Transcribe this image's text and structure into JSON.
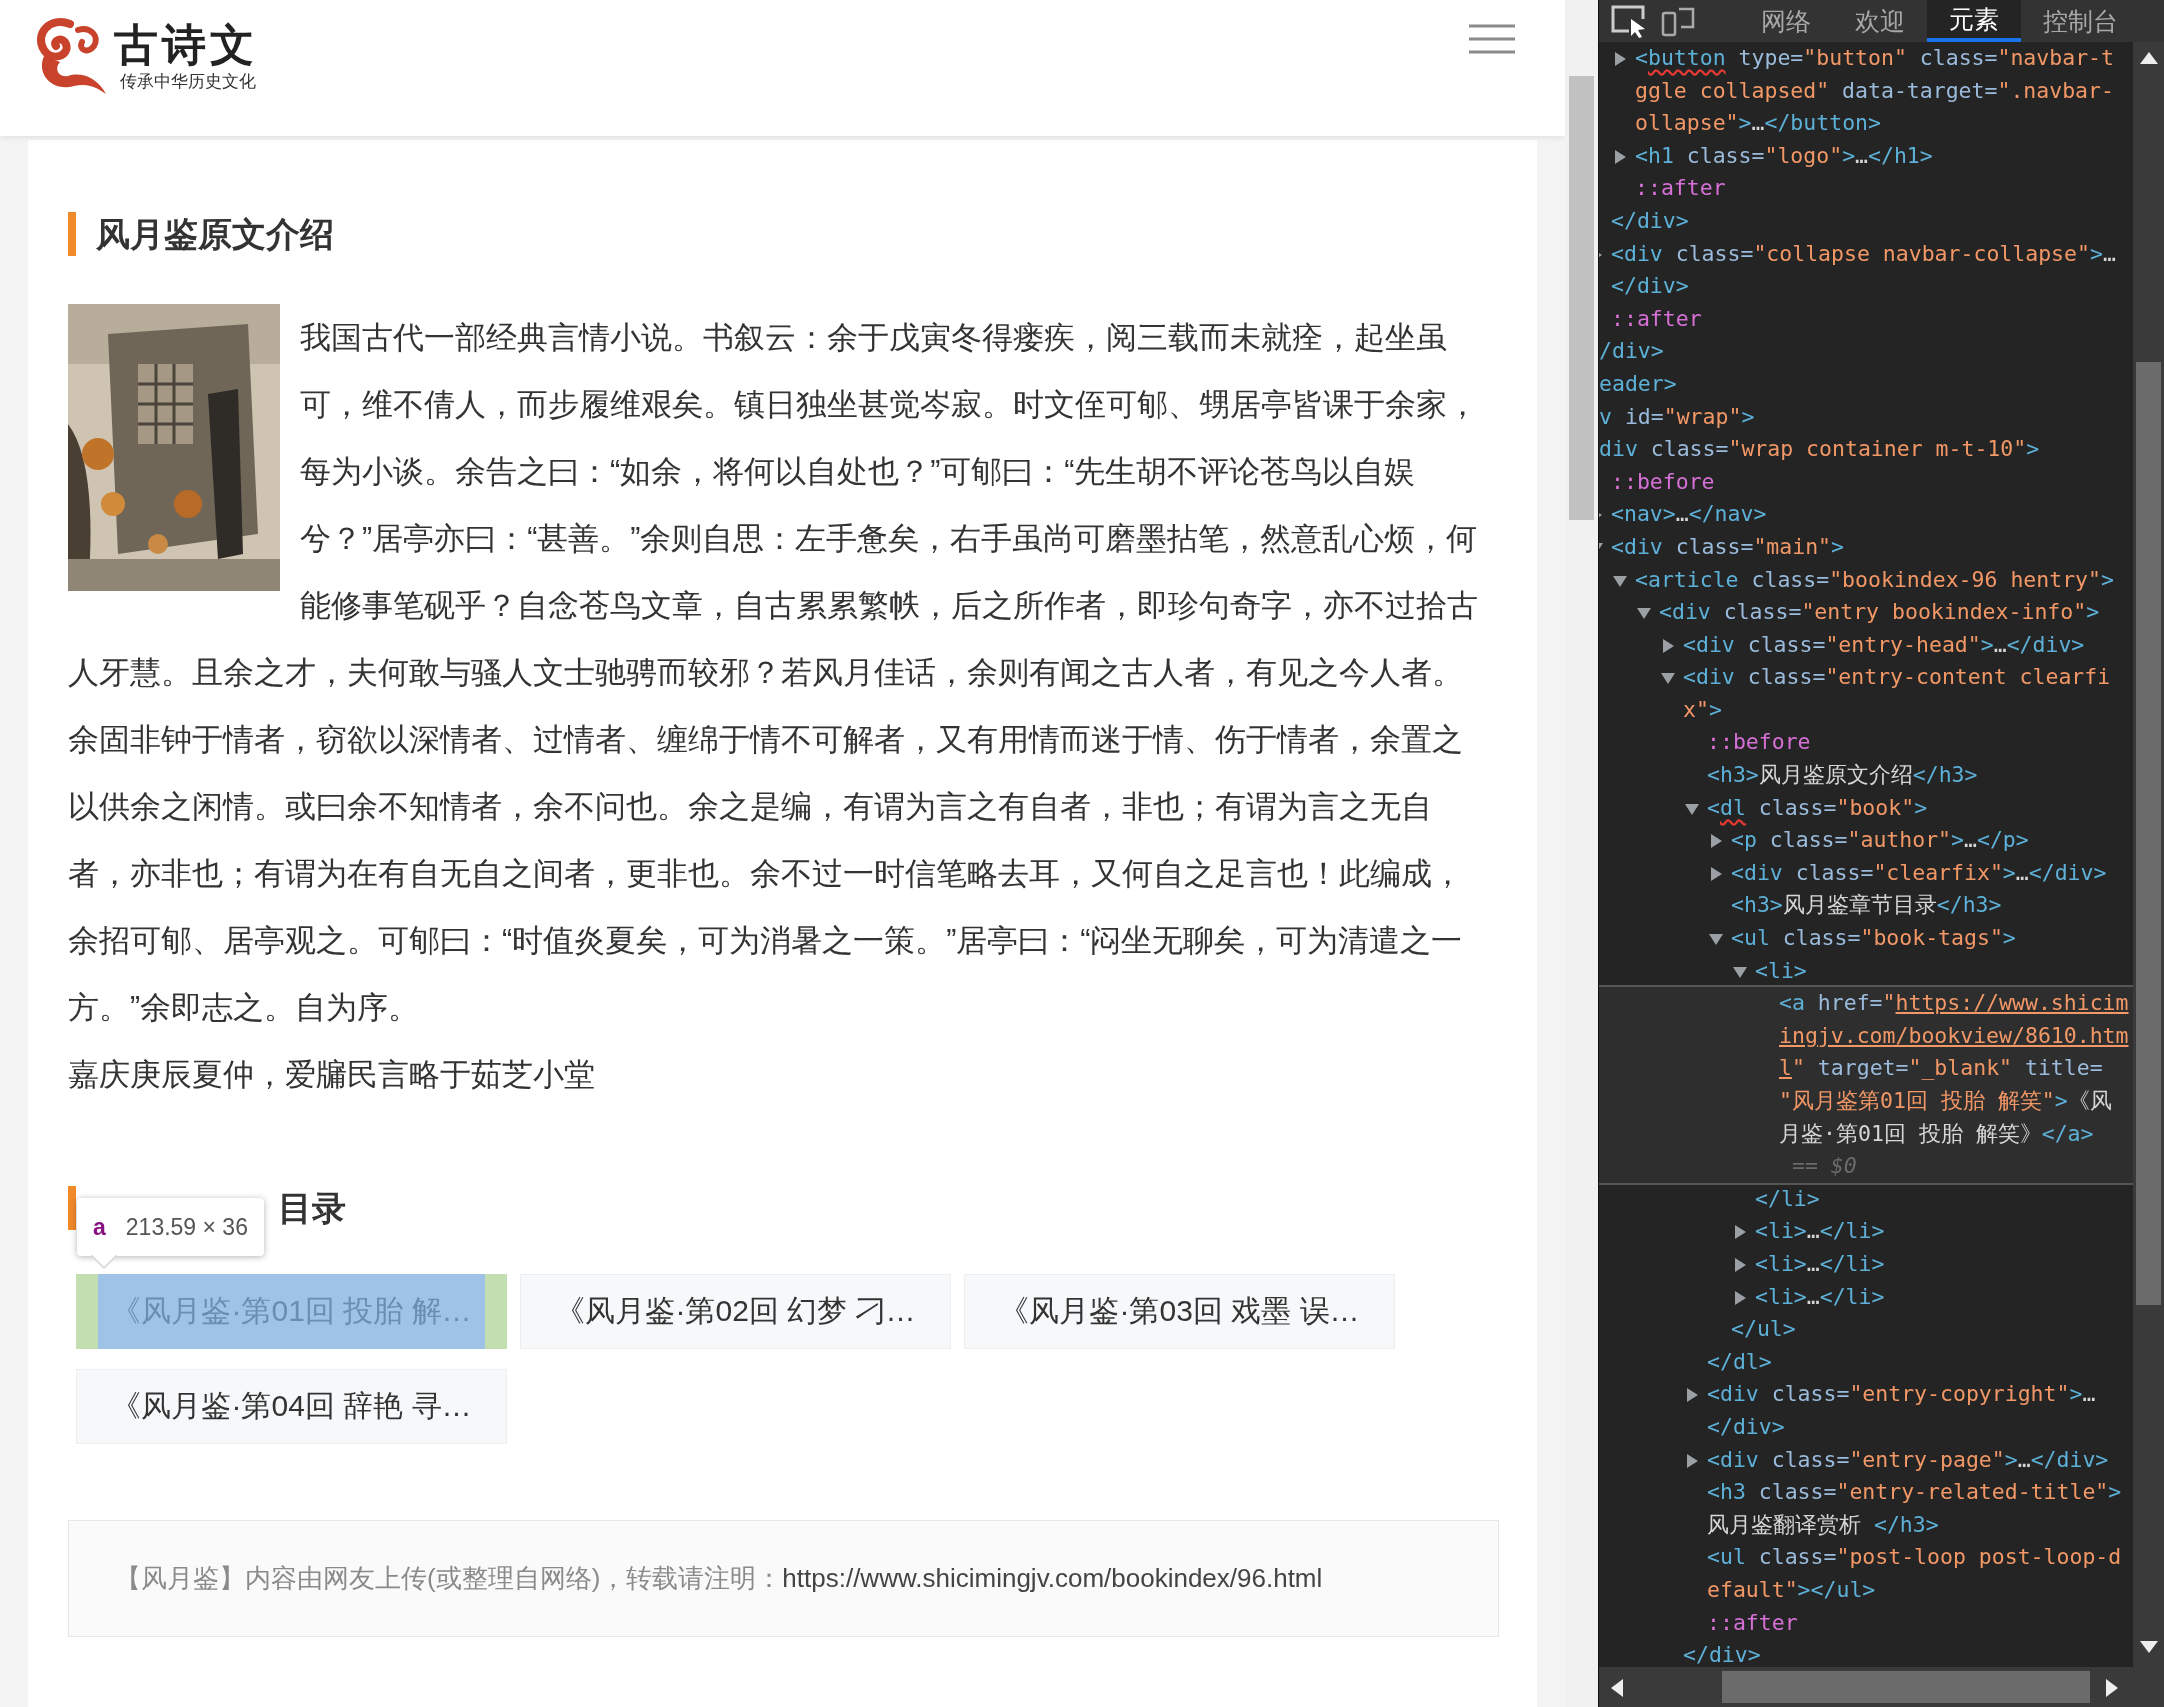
{
  "page": {
    "logo": {
      "title": "古诗文",
      "slogan": "传承中华历史文化"
    },
    "intro": {
      "heading": "风月鉴原文介绍",
      "image": {
        "kind": "picture"
      },
      "paragraphs": [
        "我国古代一部经典言情小说。书叙云：余于戊寅冬得瘘疾，阅三载而未就痊，起坐虽可，维不倩人，而步履维艰矣。镇日独坐甚觉岑寂。时文侄可郇、甥居亭皆课于余家，每为小谈。余告之曰：“如余，将何以自处也？”可郇曰：“先生胡不评论苍鸟以自娱兮？”居亭亦曰：“甚善。”余则自思：左手惫矣，右手虽尚可磨墨拈笔，然意乱心烦，何能修事笔砚乎？自念苍鸟文章，自古累累繁帙，后之所作者，即珍句奇字，亦不过拾古人牙慧。且余之才，夫何敢与骚人文士驰骋而较邪？若风月佳话，余则有闻之古人者，有见之今人者。余固非钟于情者，窃欲以深情者、过情者、缠绵于情不可解者，又有用情而迷于情、伤于情者，余置之以供余之闲情。或曰余不知情者，余不问也。余之是编，有谓为言之有自者，非也；有谓为言之无自者，亦非也；有谓为在有自无自之间者，更非也。余不过一时信笔略去耳，又何自之足言也！此编成，余招可郇、居亭观之。可郇曰：“时值炎夏矣，可为消暑之一策。”居亭曰：“闷坐无聊矣，可为清遣之一方。”余即志之。自为序。",
        "嘉庆庚辰夏仲，爱牖民言略于茹芝小堂"
      ]
    },
    "chapters": {
      "heading": "目录",
      "tooltip": {
        "tag": "a",
        "size": "213.59 × 36"
      },
      "tags": [
        {
          "label": "《风月鉴·第01回 投胎 解…",
          "highlighted": true
        },
        {
          "label": "《风月鉴·第02回 幻梦 刁…",
          "highlighted": false
        },
        {
          "label": "《风月鉴·第03回 戏墨 误…",
          "highlighted": false
        },
        {
          "label": "《风月鉴·第04回 辞艳 寻…",
          "highlighted": false
        }
      ]
    },
    "copyright": {
      "notice": "【风月鉴】内容由网友上传(或整理自网络)，转载请注明：",
      "link": "https://www.shicimingjv.com/bookindex/96.html"
    }
  },
  "devtools": {
    "tabs": [
      {
        "label": "网络",
        "selected": false
      },
      {
        "label": "欢迎",
        "selected": false
      },
      {
        "label": "元素",
        "selected": true
      },
      {
        "label": "控制台",
        "selected": false
      }
    ],
    "dom_tree": [
      {
        "children": [
          {
            "children": [
              {
                "selected": false,
                "expanded": false,
                "lines": [
                  [
                    {
                      "kind": "tag",
                      "text": "<"
                    },
                    {
                      "kind": "warn",
                      "text": "button"
                    },
                    {
                      "kind": "attr",
                      "text": " type="
                    },
                    {
                      "kind": "val",
                      "text": "\"button\""
                    },
                    {
                      "kind": "attr",
                      "text": " class="
                    },
                    {
                      "kind": "val",
                      "text": "\"navbar-t"
                    }
                  ],
                  [
                    {
                      "kind": "val",
                      "text": "ggle collapsed\""
                    },
                    {
                      "kind": "attr",
                      "text": " data-target="
                    },
                    {
                      "kind": "val",
                      "text": "\".navbar-"
                    }
                  ],
                  [
                    {
                      "kind": "val",
                      "text": "ollapse\""
                    },
                    {
                      "kind": "tag",
                      "text": ">"
                    },
                    {
                      "kind": "text",
                      "text": "…"
                    },
                    {
                      "kind": "tag",
                      "text": "</button>"
                    }
                  ]
                ]
              },
              {
                "selected": false,
                "expanded": false,
                "lines": [
                  [
                    {
                      "kind": "tag",
                      "text": "<h1"
                    },
                    {
                      "kind": "attr",
                      "text": " class="
                    },
                    {
                      "kind": "val",
                      "text": "\"logo\""
                    },
                    {
                      "kind": "tag",
                      "text": ">"
                    },
                    {
                      "kind": "text",
                      "text": "…"
                    },
                    {
                      "kind": "tag",
                      "text": "</h1>"
                    }
                  ]
                ]
              },
              {
                "selected": false,
                "lines": [
                  [
                    {
                      "kind": "pseudo",
                      "text": "::after"
                    }
                  ]
                ]
              }
            ]
          },
          {
            "selected": false,
            "lines": [
              [
                {
                  "kind": "tag",
                  "text": "</div>"
                }
              ]
            ]
          },
          {
            "selected": false,
            "expanded": false,
            "lines": [
              [
                {
                  "kind": "tag",
                  "text": "<div"
                },
                {
                  "kind": "attr",
                  "text": " class="
                },
                {
                  "kind": "val",
                  "text": "\"collapse navbar-collapse\""
                },
                {
                  "kind": "tag",
                  "text": ">"
                },
                {
                  "kind": "text",
                  "text": "…"
                }
              ],
              [
                {
                  "kind": "tag",
                  "text": "</div>"
                }
              ]
            ]
          },
          {
            "selected": false,
            "lines": [
              [
                {
                  "kind": "pseudo",
                  "text": "::after"
                }
              ]
            ]
          }
        ]
      },
      {
        "selected": false,
        "lines": [
          [
            {
              "kind": "tag",
              "text": "/div>"
            }
          ]
        ]
      },
      {
        "selected": false,
        "lines": [
          [
            {
              "kind": "tag",
              "text": "eader>"
            }
          ]
        ]
      },
      {
        "selected": false,
        "lines": [
          [
            {
              "kind": "tag",
              "text": "v"
            },
            {
              "kind": "attr",
              "text": " id="
            },
            {
              "kind": "val",
              "text": "\"wrap\""
            },
            {
              "kind": "tag",
              "text": ">"
            }
          ]
        ]
      },
      {
        "selected": false,
        "lines": [
          [
            {
              "kind": "tag",
              "text": "div"
            },
            {
              "kind": "attr",
              "text": " class="
            },
            {
              "kind": "val",
              "text": "\"wrap container m-t-10\""
            },
            {
              "kind": "tag",
              "text": ">"
            }
          ]
        ],
        "children": [
          {
            "selected": false,
            "lines": [
              [
                {
                  "kind": "pseudo",
                  "text": "::before"
                }
              ]
            ]
          },
          {
            "selected": false,
            "expanded": false,
            "lines": [
              [
                {
                  "kind": "tag",
                  "text": "<nav>"
                },
                {
                  "kind": "text",
                  "text": "…"
                },
                {
                  "kind": "tag",
                  "text": "</nav>"
                }
              ]
            ]
          },
          {
            "selected": false,
            "expanded": true,
            "lines": [
              [
                {
                  "kind": "tag",
                  "text": "<div"
                },
                {
                  "kind": "attr",
                  "text": " class="
                },
                {
                  "kind": "val",
                  "text": "\"main\""
                },
                {
                  "kind": "tag",
                  "text": ">"
                }
              ]
            ],
            "children": [
              {
                "selected": false,
                "expanded": true,
                "lines": [
                  [
                    {
                      "kind": "tag",
                      "text": "<article"
                    },
                    {
                      "kind": "attr",
                      "text": " class="
                    },
                    {
                      "kind": "val",
                      "text": "\"bookindex-96 hentry\""
                    },
                    {
                      "kind": "tag",
                      "text": ">"
                    }
                  ]
                ],
                "children": [
                  {
                    "selected": false,
                    "expanded": true,
                    "lines": [
                      [
                        {
                          "kind": "tag",
                          "text": "<div"
                        },
                        {
                          "kind": "attr",
                          "text": " class="
                        },
                        {
                          "kind": "val",
                          "text": "\"entry bookindex-info\""
                        },
                        {
                          "kind": "tag",
                          "text": ">"
                        }
                      ]
                    ],
                    "children": [
                      {
                        "selected": false,
                        "expanded": false,
                        "lines": [
                          [
                            {
                              "kind": "tag",
                              "text": "<div"
                            },
                            {
                              "kind": "attr",
                              "text": " class="
                            },
                            {
                              "kind": "val",
                              "text": "\"entry-head\""
                            },
                            {
                              "kind": "tag",
                              "text": ">"
                            },
                            {
                              "kind": "text",
                              "text": "…"
                            },
                            {
                              "kind": "tag",
                              "text": "</div>"
                            }
                          ]
                        ]
                      },
                      {
                        "selected": false,
                        "expanded": true,
                        "lines": [
                          [
                            {
                              "kind": "tag",
                              "text": "<div"
                            },
                            {
                              "kind": "attr",
                              "text": " class="
                            },
                            {
                              "kind": "val",
                              "text": "\"entry-content clearfi"
                            }
                          ],
                          [
                            {
                              "kind": "val",
                              "text": "x\""
                            },
                            {
                              "kind": "tag",
                              "text": ">"
                            }
                          ]
                        ],
                        "children": [
                          {
                            "selected": false,
                            "lines": [
                              [
                                {
                                  "kind": "pseudo",
                                  "text": "::before"
                                }
                              ]
                            ]
                          },
                          {
                            "selected": false,
                            "lines": [
                              [
                                {
                                  "kind": "tag",
                                  "text": "<h3>"
                                },
                                {
                                  "kind": "text",
                                  "text": "风月鉴原文介绍"
                                },
                                {
                                  "kind": "tag",
                                  "text": "</h3>"
                                }
                              ]
                            ]
                          },
                          {
                            "selected": false,
                            "expanded": true,
                            "lines": [
                              [
                                {
                                  "kind": "tag",
                                  "text": "<"
                                },
                                {
                                  "kind": "warn",
                                  "text": "dl"
                                },
                                {
                                  "kind": "attr",
                                  "text": " class="
                                },
                                {
                                  "kind": "val",
                                  "text": "\"book\""
                                },
                                {
                                  "kind": "tag",
                                  "text": ">"
                                }
                              ]
                            ],
                            "children": [
                              {
                                "selected": false,
                                "expanded": false,
                                "lines": [
                                  [
                                    {
                                      "kind": "tag",
                                      "text": "<p"
                                    },
                                    {
                                      "kind": "attr",
                                      "text": " class="
                                    },
                                    {
                                      "kind": "val",
                                      "text": "\"author\""
                                    },
                                    {
                                      "kind": "tag",
                                      "text": ">"
                                    },
                                    {
                                      "kind": "text",
                                      "text": "…"
                                    },
                                    {
                                      "kind": "tag",
                                      "text": "</p>"
                                    }
                                  ]
                                ]
                              },
                              {
                                "selected": false,
                                "expanded": false,
                                "lines": [
                                  [
                                    {
                                      "kind": "tag",
                                      "text": "<div"
                                    },
                                    {
                                      "kind": "attr",
                                      "text": " class="
                                    },
                                    {
                                      "kind": "val",
                                      "text": "\"clearfix\""
                                    },
                                    {
                                      "kind": "tag",
                                      "text": ">"
                                    },
                                    {
                                      "kind": "text",
                                      "text": "…"
                                    },
                                    {
                                      "kind": "tag",
                                      "text": "</div>"
                                    }
                                  ]
                                ]
                              },
                              {
                                "selected": false,
                                "lines": [
                                  [
                                    {
                                      "kind": "tag",
                                      "text": "<h3>"
                                    },
                                    {
                                      "kind": "text",
                                      "text": "风月鉴章节目录"
                                    },
                                    {
                                      "kind": "tag",
                                      "text": "</h3>"
                                    }
                                  ]
                                ]
                              },
                              {
                                "selected": false,
                                "expanded": true,
                                "lines": [
                                  [
                                    {
                                      "kind": "tag",
                                      "text": "<ul"
                                    },
                                    {
                                      "kind": "attr",
                                      "text": " class="
                                    },
                                    {
                                      "kind": "val",
                                      "text": "\"book-tags\""
                                    },
                                    {
                                      "kind": "tag",
                                      "text": ">"
                                    }
                                  ]
                                ],
                                "children": [
                                  {
                                    "selected": false,
                                    "expanded": true,
                                    "lines": [
                                      [
                                        {
                                          "kind": "tag",
                                          "text": "<li>"
                                        }
                                      ]
                                    ],
                                    "children": [
                                      {
                                        "selected": true,
                                        "lines": [
                                          [
                                            {
                                              "kind": "tag",
                                              "text": "<a"
                                            },
                                            {
                                              "kind": "attr",
                                              "text": " href="
                                            },
                                            {
                                              "kind": "val",
                                              "text": "\""
                                            },
                                            {
                                              "kind": "link",
                                              "text": "https://www.shicim"
                                            }
                                          ],
                                          [
                                            {
                                              "kind": "link",
                                              "text": "ingjv.com/bookview/8610.htm"
                                            }
                                          ],
                                          [
                                            {
                                              "kind": "link",
                                              "text": "l"
                                            },
                                            {
                                              "kind": "val",
                                              "text": "\""
                                            },
                                            {
                                              "kind": "attr",
                                              "text": " target="
                                            },
                                            {
                                              "kind": "val",
                                              "text": "\"_blank\""
                                            },
                                            {
                                              "kind": "attr",
                                              "text": " title="
                                            }
                                          ],
                                          [
                                            {
                                              "kind": "val",
                                              "text": "\"风月鉴第01回 投胎 解笑\""
                                            },
                                            {
                                              "kind": "tag",
                                              "text": ">"
                                            },
                                            {
                                              "kind": "text",
                                              "text": "《风"
                                            }
                                          ],
                                          [
                                            {
                                              "kind": "text",
                                              "text": "月鉴·第01回 投胎 解笑》"
                                            },
                                            {
                                              "kind": "tag",
                                              "text": "</a>"
                                            }
                                          ],
                                          [
                                            {
                                              "kind": "dim",
                                              "text": " == $0"
                                            }
                                          ]
                                        ]
                                      }
                                    ]
                                  },
                                  {
                                    "selected": false,
                                    "lines": [
                                      [
                                        {
                                          "kind": "tag",
                                          "text": "</li>"
                                        }
                                      ]
                                    ]
                                  },
                                  {
                                    "selected": false,
                                    "expanded": false,
                                    "lines": [
                                      [
                                        {
                                          "kind": "tag",
                                          "text": "<li>"
                                        },
                                        {
                                          "kind": "text",
                                          "text": "…"
                                        },
                                        {
                                          "kind": "tag",
                                          "text": "</li>"
                                        }
                                      ]
                                    ]
                                  },
                                  {
                                    "selected": false,
                                    "expanded": false,
                                    "lines": [
                                      [
                                        {
                                          "kind": "tag",
                                          "text": "<li>"
                                        },
                                        {
                                          "kind": "text",
                                          "text": "…"
                                        },
                                        {
                                          "kind": "tag",
                                          "text": "</li>"
                                        }
                                      ]
                                    ]
                                  },
                                  {
                                    "selected": false,
                                    "expanded": false,
                                    "lines": [
                                      [
                                        {
                                          "kind": "tag",
                                          "text": "<li>"
                                        },
                                        {
                                          "kind": "text",
                                          "text": "…"
                                        },
                                        {
                                          "kind": "tag",
                                          "text": "</li>"
                                        }
                                      ]
                                    ]
                                  }
                                ]
                              },
                              {
                                "selected": false,
                                "lines": [
                                  [
                                    {
                                      "kind": "tag",
                                      "text": "</ul>"
                                    }
                                  ]
                                ]
                              }
                            ]
                          },
                          {
                            "selected": false,
                            "lines": [
                              [
                                {
                                  "kind": "tag",
                                  "text": "</dl>"
                                }
                              ]
                            ]
                          },
                          {
                            "selected": false,
                            "expanded": false,
                            "lines": [
                              [
                                {
                                  "kind": "tag",
                                  "text": "<div"
                                },
                                {
                                  "kind": "attr",
                                  "text": " class="
                                },
                                {
                                  "kind": "val",
                                  "text": "\"entry-copyright\""
                                },
                                {
                                  "kind": "tag",
                                  "text": ">"
                                },
                                {
                                  "kind": "text",
                                  "text": "…"
                                }
                              ],
                              [
                                {
                                  "kind": "tag",
                                  "text": "</div>"
                                }
                              ]
                            ]
                          },
                          {
                            "selected": false,
                            "expanded": false,
                            "lines": [
                              [
                                {
                                  "kind": "tag",
                                  "text": "<div"
                                },
                                {
                                  "kind": "attr",
                                  "text": " class="
                                },
                                {
                                  "kind": "val",
                                  "text": "\"entry-page\""
                                },
                                {
                                  "kind": "tag",
                                  "text": ">"
                                },
                                {
                                  "kind": "text",
                                  "text": "…"
                                },
                                {
                                  "kind": "tag",
                                  "text": "</div>"
                                }
                              ]
                            ]
                          },
                          {
                            "selected": false,
                            "lines": [
                              [
                                {
                                  "kind": "tag",
                                  "text": "<h3"
                                },
                                {
                                  "kind": "attr",
                                  "text": " class="
                                },
                                {
                                  "kind": "val",
                                  "text": "\"entry-related-title\""
                                },
                                {
                                  "kind": "tag",
                                  "text": ">"
                                }
                              ],
                              [
                                {
                                  "kind": "text",
                                  "text": "风月鉴翻译赏析 "
                                },
                                {
                                  "kind": "tag",
                                  "text": "</h3>"
                                }
                              ]
                            ]
                          },
                          {
                            "selected": false,
                            "lines": [
                              [
                                {
                                  "kind": "tag",
                                  "text": "<ul"
                                },
                                {
                                  "kind": "attr",
                                  "text": " class="
                                },
                                {
                                  "kind": "val",
                                  "text": "\"post-loop post-loop-d"
                                }
                              ],
                              [
                                {
                                  "kind": "val",
                                  "text": "efault\""
                                },
                                {
                                  "kind": "tag",
                                  "text": "></ul>"
                                }
                              ]
                            ]
                          },
                          {
                            "selected": false,
                            "lines": [
                              [
                                {
                                  "kind": "pseudo",
                                  "text": "::after"
                                }
                              ]
                            ]
                          }
                        ]
                      },
                      {
                        "selected": false,
                        "lines": [
                          [
                            {
                              "kind": "tag",
                              "text": "</div>"
                            }
                          ]
                        ]
                      }
                    ]
                  }
                ]
              }
            ]
          }
        ]
      }
    ]
  }
}
